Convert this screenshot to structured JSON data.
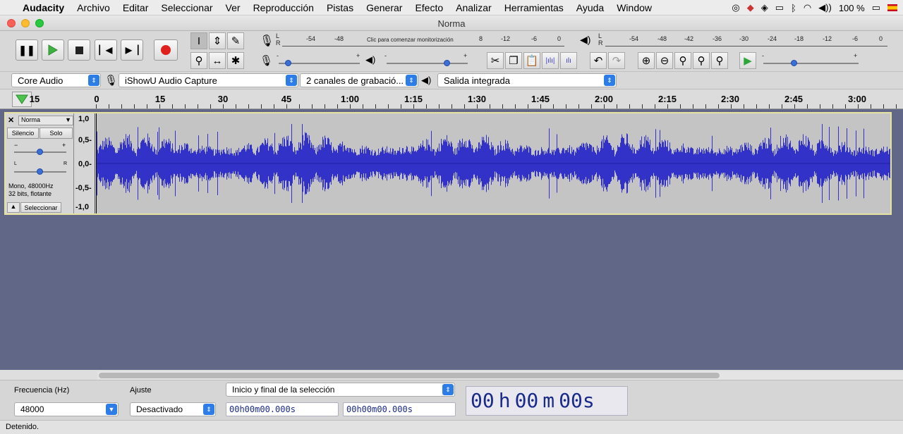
{
  "menubar": {
    "app_name": "Audacity",
    "items": [
      "Archivo",
      "Editar",
      "Seleccionar",
      "Ver",
      "Reproducción",
      "Pistas",
      "Generar",
      "Efecto",
      "Analizar",
      "Herramientas",
      "Ayuda",
      "Window"
    ],
    "battery": "100 %"
  },
  "window": {
    "title": "Norma"
  },
  "transport": {
    "buttons": [
      "pause",
      "play",
      "stop",
      "skip-start",
      "skip-end",
      "record"
    ]
  },
  "meters": {
    "record_lr": [
      "L",
      "R"
    ],
    "record_ticks": [
      "-54",
      "-48"
    ],
    "record_prompt": "Clic para comenzar monitorización",
    "record_ticks2": [
      "8",
      "-12",
      "-6",
      "0"
    ],
    "play_lr": [
      "L",
      "R"
    ],
    "play_ticks": [
      "-54",
      "-48",
      "-42",
      "-36",
      "-30",
      "-24",
      "-18",
      "-12",
      "-6",
      "0"
    ],
    "minus": "-",
    "plus": "+"
  },
  "devices": {
    "host": "Core Audio",
    "input": "iShowU Audio Capture",
    "channels": "2 canales de grabació...",
    "output": "Salida integrada"
  },
  "ruler": {
    "labels": [
      "15",
      "0",
      "15",
      "30",
      "45",
      "1:00",
      "1:15",
      "1:30",
      "1:45",
      "2:00",
      "2:15",
      "2:30",
      "2:45",
      "3:00"
    ]
  },
  "track": {
    "name": "Norma",
    "mute": "Silencio",
    "solo": "Solo",
    "gain_minus": "−",
    "gain_plus": "+",
    "pan_l": "L",
    "pan_r": "R",
    "info_line1": "Mono, 48000Hz",
    "info_line2": "32 bits, flotante",
    "select": "Seleccionar",
    "scale": [
      "1,0",
      "0,5-",
      "0,0-",
      "-0,5-",
      "-1,0"
    ]
  },
  "selection_bar": {
    "rate_label": "Frecuencia (Hz)",
    "rate_value": "48000",
    "snap_label": "Ajuste",
    "snap_value": "Desactivado",
    "mode_value": "Inicio y final de la selección",
    "start_time": "00h00m00.000s",
    "end_time": "00h00m00.000s",
    "big_time": {
      "h": "00",
      "h_unit": "h",
      "m": "00",
      "m_unit": "m",
      "s": "00",
      "s_unit": "s"
    }
  },
  "status": {
    "text": "Detenido."
  },
  "colors": {
    "waveform": "#3232c8",
    "track_bg": "#616787",
    "selection_border": "#e6e2a0"
  }
}
